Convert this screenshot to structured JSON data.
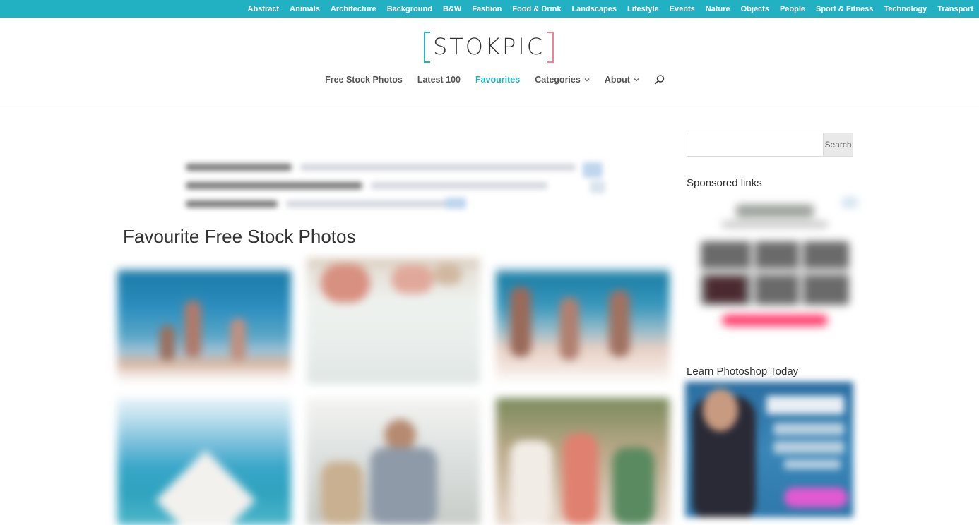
{
  "topbar": {
    "categories": [
      "Abstract",
      "Animals",
      "Architecture",
      "Background",
      "B&W",
      "Fashion",
      "Food & Drink",
      "Landscapes",
      "Lifestyle",
      "Events",
      "Nature",
      "Objects",
      "People",
      "Sport & Fitness",
      "Technology",
      "Transport"
    ]
  },
  "header": {
    "logo_text": "STOKPIC",
    "nav": {
      "free_stock_photos": "Free Stock Photos",
      "latest_100": "Latest 100",
      "favourites": "Favourites",
      "categories": "Categories",
      "about": "About"
    }
  },
  "main": {
    "title": "Favourite Free Stock Photos"
  },
  "sidebar": {
    "search_placeholder": "",
    "search_button": "Search",
    "sponsored_heading": "Sponsored links",
    "photoshop_heading": "Learn Photoshop Today"
  },
  "colors": {
    "accent": "#22b1c3",
    "logo_pink": "#f3809a"
  },
  "icons": {
    "search": "search-icon",
    "chevron": "chevron-down-icon"
  }
}
